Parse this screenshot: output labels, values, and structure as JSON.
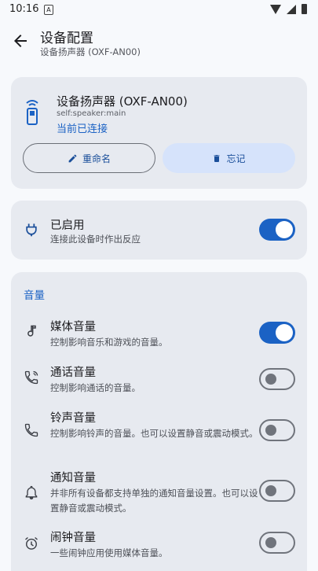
{
  "status_bar": {
    "time": "10:16",
    "notif_letter": "A"
  },
  "header": {
    "title": "设备配置",
    "subtitle": "设备扬声器 (OXF-AN00)"
  },
  "device": {
    "name": "设备扬声器 (OXF-AN00)",
    "id": "self:speaker:main",
    "status": "当前已连接",
    "rename_label": "重命名",
    "forget_label": "忘记"
  },
  "enabled": {
    "title": "已启用",
    "desc": "连接此设备时作出反应",
    "on": true
  },
  "volume": {
    "section_title": "音量",
    "items": [
      {
        "title": "媒体音量",
        "desc": "控制影响音乐和游戏的音量。",
        "on": true
      },
      {
        "title": "通话音量",
        "desc": "控制影响通话的音量。",
        "on": false
      },
      {
        "title": "铃声音量",
        "desc": "控制影响铃声的音量。也可以设置静音或震动模式。",
        "on": false
      },
      {
        "title": "通知音量",
        "desc": "并非所有设备都支持单独的通知音量设置。也可以设置静音或震动模式。",
        "on": false
      },
      {
        "title": "闹钟音量",
        "desc": "一些闹钟应用使用媒体音量。",
        "on": false
      }
    ]
  },
  "colors": {
    "accent": "#1b62c4",
    "card": "#e7eaf0",
    "background": "#f7f9fc"
  }
}
